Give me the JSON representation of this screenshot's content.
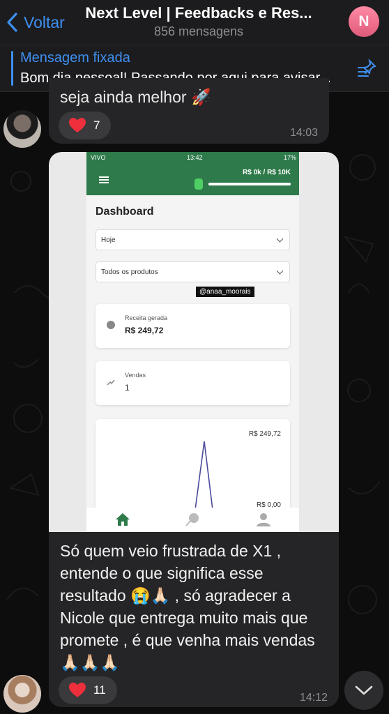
{
  "header": {
    "back_label": "Voltar",
    "title": "Next Level | Feedbacks e Res...",
    "subtitle": "856 mensagens",
    "avatar_letter": "N"
  },
  "pinned": {
    "label": "Mensagem fixada",
    "text": "Bom dia pessoal! Passando por aqui para avisar..."
  },
  "messages": [
    {
      "text_fragment": "seja ainda melhor 🚀",
      "reaction_emoji": "heart-icon",
      "reaction_count": "7",
      "time": "14:03"
    },
    {
      "text": "Só quem veio frustrada de X1 , entende o que significa esse resultado 😭🙏🏻 , só agradecer a Nicole que entrega muito mais que promete , é que venha mais vendas 🙏🏻🙏🏻🙏🏻",
      "reaction_emoji": "heart-icon",
      "reaction_count": "11",
      "time": "14:12",
      "screenshot": {
        "status_carrier": "VIVO",
        "status_time": "13:42",
        "status_battery": "17%",
        "goal_text": "R$ 0k / R$ 10K",
        "dashboard_title": "Dashboard",
        "filter_period": "Hoje",
        "filter_products": "Todos os produtos",
        "watermark": "@anaa_moorais",
        "revenue_label": "Receita gerada",
        "revenue_value": "R$ 249,72",
        "sales_label": "Vendas",
        "sales_value": "1",
        "chart_max_label": "R$ 249,72",
        "chart_min_label": "R$ 0,00"
      }
    }
  ],
  "colors": {
    "accent": "#3e8ff0",
    "bubble": "#252527",
    "app_green": "#2e7a4a",
    "avatar_pink": "#e05a7a"
  }
}
